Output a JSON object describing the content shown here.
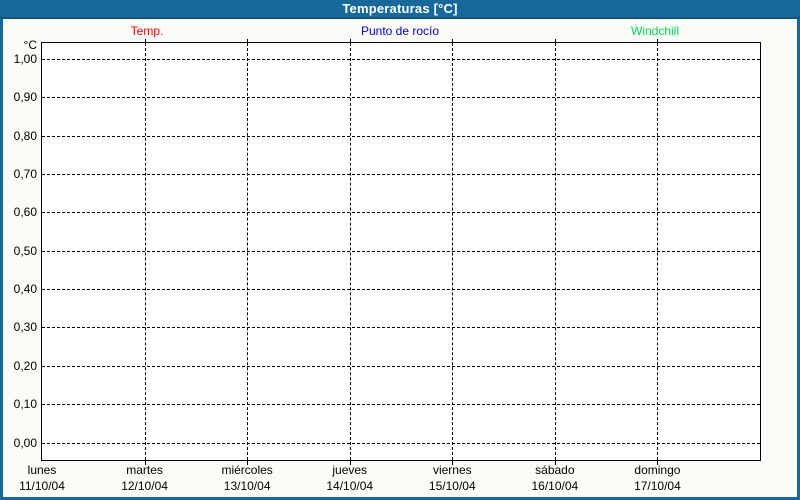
{
  "title": "Temperaturas [°C]",
  "colors": {
    "titlebar_bg": "#17699C",
    "titlebar_edge": "#0D5580",
    "window_border": "#17699C",
    "background": "#FBFBF7",
    "plot_background": "#FFFFFF",
    "grid": "#000000",
    "title_text": "#FFFFFF",
    "axis_text": "#000000",
    "temp": "#FF0000",
    "dew_point": "#0000EE",
    "windchill": "#00DC50"
  },
  "legend": {
    "items": [
      {
        "label": "Temp.",
        "color": "#FF0000"
      },
      {
        "label": "Punto de rocío",
        "color": "#0000EE"
      },
      {
        "label": "Windchill",
        "color": "#00DC50"
      }
    ]
  },
  "chart_data": {
    "type": "line",
    "title": "Temperaturas [°C]",
    "ylabel": "°C",
    "xlabel": "",
    "ylim": [
      0.0,
      1.0
    ],
    "ytick_step": 0.1,
    "ytick_labels": [
      "1,00",
      "0,90",
      "0,80",
      "0,70",
      "0,60",
      "0,50",
      "0,40",
      "0,30",
      "0,20",
      "0,10",
      "0,00"
    ],
    "ytick_values": [
      1.0,
      0.9,
      0.8,
      0.7,
      0.6,
      0.5,
      0.4,
      0.3,
      0.2,
      0.1,
      0.0
    ],
    "x_categories": [
      {
        "day": "lunes",
        "date": "11/10/04"
      },
      {
        "day": "martes",
        "date": "12/10/04"
      },
      {
        "day": "miércoles",
        "date": "13/10/04"
      },
      {
        "day": "jueves",
        "date": "14/10/04"
      },
      {
        "day": "viernes",
        "date": "15/10/04"
      },
      {
        "day": "sábado",
        "date": "16/10/04"
      },
      {
        "day": "domingo",
        "date": "17/10/04"
      }
    ],
    "series": [
      {
        "name": "Temp.",
        "color": "#FF0000",
        "values": []
      },
      {
        "name": "Punto de rocío",
        "color": "#0000EE",
        "values": []
      },
      {
        "name": "Windchill",
        "color": "#00DC50",
        "values": []
      }
    ],
    "grid": true,
    "grid_style": "dashed",
    "legend_position": "top"
  }
}
